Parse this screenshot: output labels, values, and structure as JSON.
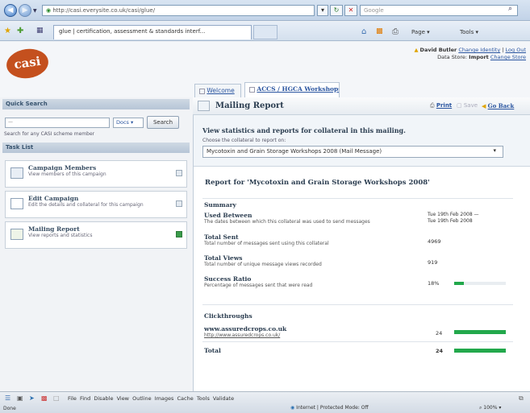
{
  "browser": {
    "url": "http://casi.everysite.co.uk/casi/glue/",
    "search_placeholder": "Google",
    "tab_title": "glue | certification, assessment & standards interf...",
    "commands": [
      "Page ▾",
      "Tools ▾"
    ]
  },
  "app": {
    "logo_text": "casi",
    "user_label": "David Butler",
    "change_identity": "Change Identity",
    "logout": "Log Out",
    "data_store_label": "Data Store:",
    "data_store_value": "Import",
    "change_store": "Change Store",
    "tabs": [
      "Welcome",
      "ACCS / HGCA Workshops"
    ]
  },
  "sidebar": {
    "quick_search_title": "Quick Search",
    "search_value": "—",
    "filter_label": "Docs ▾",
    "search_button": "Search",
    "search_hint": "Search for any CASI scheme member",
    "task_list_title": "Task List",
    "tasks": [
      {
        "title": "Campaign Members",
        "desc": "View members of this campaign"
      },
      {
        "title": "Edit Campaign",
        "desc": "Edit the details and collateral for this campaign"
      },
      {
        "title": "Mailing Report",
        "desc": "View reports and statistics"
      }
    ]
  },
  "main": {
    "title": "Mailing Report",
    "actions": {
      "print": "Print",
      "save": "Save",
      "back": "Go Back"
    },
    "stats_heading": "View statistics and reports for collateral in this mailing.",
    "choose_label": "Choose the collateral to report on:",
    "selected_collateral": "Mycotoxin and Grain Storage Workshops 2008 (Mail Message)",
    "report_title": "Report for 'Mycotoxin and Grain Storage Workshops 2008'",
    "summary_heading": "Summary",
    "rows": [
      {
        "label": "Used Between",
        "desc": "The dates between which this collateral was used to send messages",
        "value": "Tue 19th Feb 2008 —",
        "value2": "Tue 19th Feb 2008"
      },
      {
        "label": "Total Sent",
        "desc": "Total number of messages sent using this collateral",
        "value": "4969"
      },
      {
        "label": "Total Views",
        "desc": "Total number of unique message views recorded",
        "value": "919"
      },
      {
        "label": "Success Ratio",
        "desc": "Percentage of messages sent that were read",
        "value": "18%",
        "bar_fraction": 0.18
      }
    ],
    "clickthroughs_heading": "Clickthroughs",
    "clickthrough": {
      "label": "www.assuredcrops.co.uk",
      "url": "http://www.assuredcrops.co.uk/",
      "value": "24",
      "bar_fraction": 1.0
    },
    "total": {
      "label": "Total",
      "value": "24",
      "bar_fraction": 1.0
    }
  },
  "devbar": {
    "items": [
      "File",
      "Find",
      "Disable",
      "View",
      "Outline",
      "Images",
      "Cache",
      "Tools",
      "Validate"
    ]
  },
  "statusbar": {
    "left": "Done",
    "zone": "Internet | Protected Mode: Off",
    "zoom": "100%"
  },
  "colors": {
    "accent_green": "#22a84b",
    "logo_orange": "#c4501e",
    "link_blue": "#2a55a0"
  }
}
